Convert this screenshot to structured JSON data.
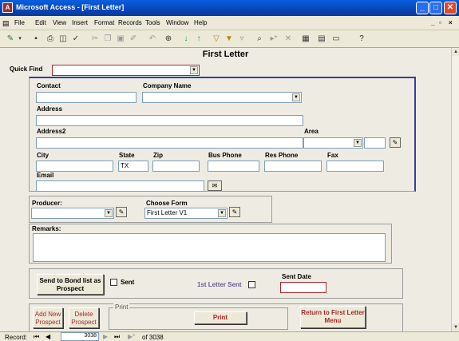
{
  "window": {
    "title": "Microsoft Access - [First Letter]"
  },
  "menu": [
    "File",
    "Edit",
    "View",
    "Insert",
    "Format",
    "Records",
    "Tools",
    "Window",
    "Help"
  ],
  "form": {
    "title": "First Letter",
    "quick_find_label": "Quick Find",
    "fields": {
      "contact": {
        "label": "Contact",
        "value": ""
      },
      "company": {
        "label": "Company  Name",
        "value": ""
      },
      "address": {
        "label": "Address",
        "value": ""
      },
      "address2": {
        "label": "Address2",
        "value": ""
      },
      "area": {
        "label": "Area",
        "value": ""
      },
      "city": {
        "label": "City",
        "value": ""
      },
      "state": {
        "label": "State",
        "value": "TX"
      },
      "zip": {
        "label": "Zip",
        "value": ""
      },
      "bus_phone": {
        "label": "Bus Phone",
        "value": ""
      },
      "res_phone": {
        "label": "Res Phone",
        "value": ""
      },
      "fax": {
        "label": "Fax",
        "value": ""
      },
      "email": {
        "label": "Email",
        "value": ""
      }
    },
    "producer": {
      "label": "Producer:",
      "value": ""
    },
    "choose_form": {
      "label": "Choose Form",
      "value": "First Letter V1"
    },
    "remarks": {
      "label": "Remarks:",
      "value": ""
    },
    "send_bond_btn": "Send to Bond list as Prospect",
    "sent_label": "Sent",
    "first_letter_sent_label": "1st Letter Sent",
    "sent_date_label": "Sent Date",
    "add_prospect_btn": "Add New Prospect",
    "delete_prospect_btn": "Delete Prospect",
    "print_group_label": "Print",
    "print_btn": "Print",
    "return_btn": "Return to First Letter Menu"
  },
  "status": {
    "record_label": "Record:",
    "current": "3038",
    "of_text": "of  3038"
  },
  "colors": {
    "titlebar": "#0a5fe0",
    "accent_red": "#a8282a",
    "purple_label": "#6a5a9a"
  }
}
